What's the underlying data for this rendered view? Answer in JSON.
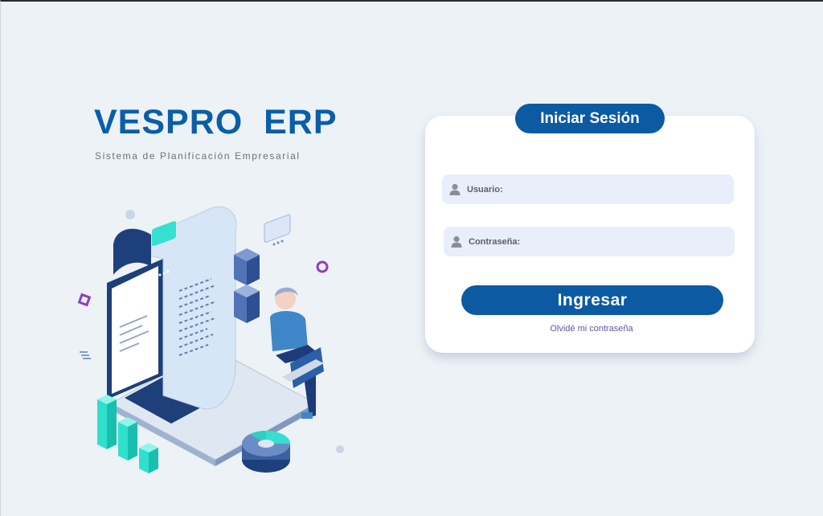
{
  "brand": {
    "title": "VESPRO  ERP",
    "subtitle": "Sistema de Planificación Empresarial",
    "primary_color": "#0a5ea8"
  },
  "login": {
    "title": "Iniciar Sesión",
    "username_label": "Usuario:",
    "username_value": "",
    "password_label": "Contraseña:",
    "password_value": "",
    "submit_label": "Ingresar",
    "forgot_password_label": "Olvidé mi contraseña",
    "icons": [
      "user-icon",
      "user-icon"
    ],
    "accent_color": "#0b5aa2"
  },
  "illustration": {
    "icon": "erp-isometric-illustration"
  }
}
